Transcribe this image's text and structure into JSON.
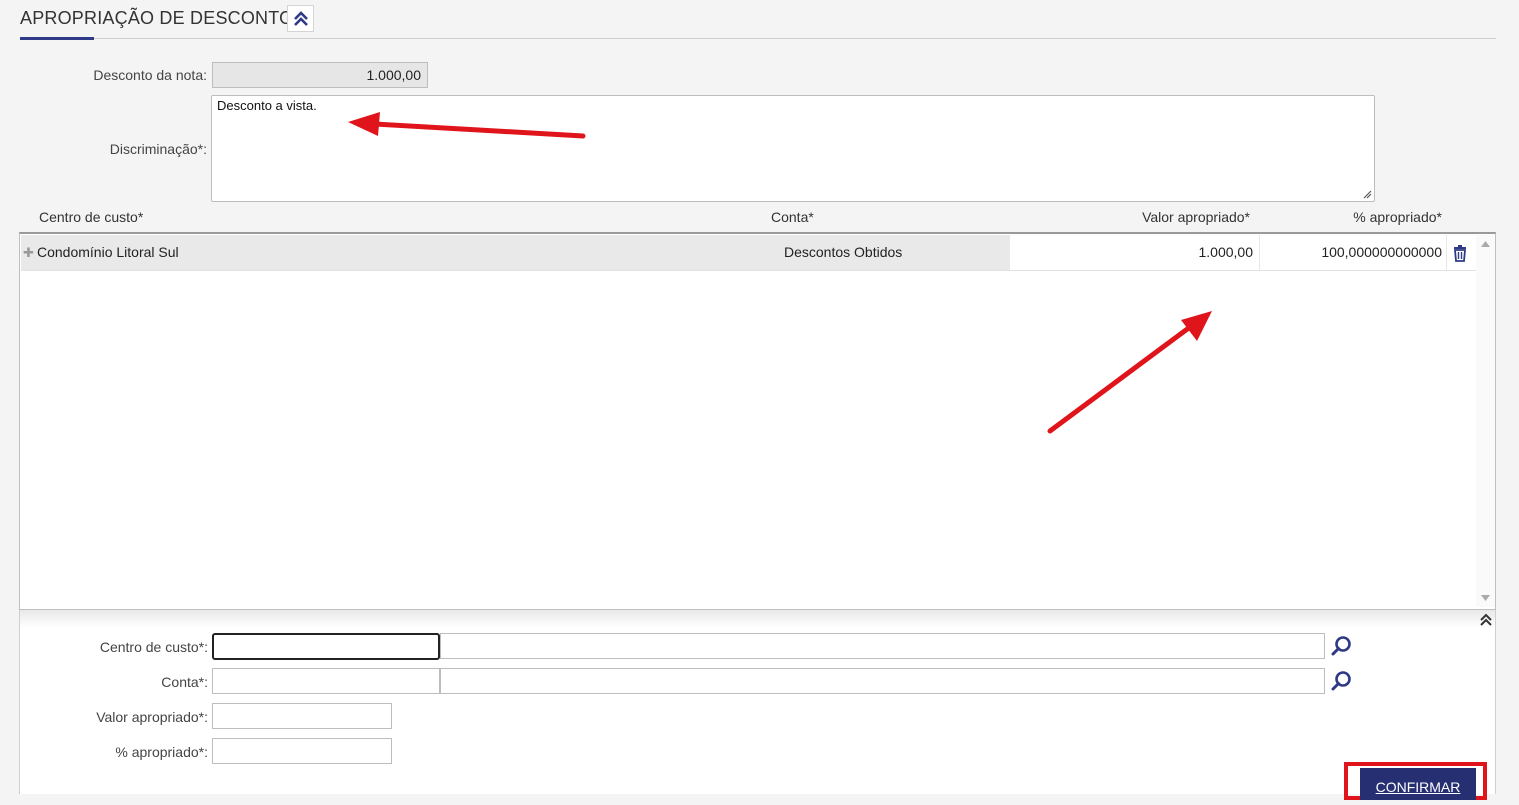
{
  "section": {
    "title": "APROPRIAÇÃO DE DESCONTO",
    "collapse_icon": "double-chevron-up-icon"
  },
  "header_form": {
    "desconto_label": "Desconto da nota:",
    "desconto_value": "1.000,00",
    "discriminacao_label": "Discriminação*:",
    "discriminacao_value": "Desconto a vista."
  },
  "grid": {
    "columns": [
      "Centro de custo*",
      "Conta*",
      "Valor apropriado*",
      "% apropriado*"
    ],
    "rows": [
      {
        "centro_de_custo": "Condomínio Litoral Sul",
        "conta": "Descontos Obtidos",
        "valor_apropriado": "1.000,00",
        "percentual_apropriado": "100,000000000000"
      }
    ],
    "row_expand_icon": "plus-icon",
    "row_delete_icon": "trash-icon"
  },
  "entry_form": {
    "centro_label": "Centro de custo*:",
    "conta_label": "Conta*:",
    "valor_label": "Valor apropriado*:",
    "percent_label": "% apropriado*:",
    "search_icon": "magnifier-icon",
    "collapse_icon": "double-chevron-up-icon"
  },
  "actions": {
    "confirm_label": "CONFIRMAR"
  },
  "colors": {
    "accent": "#2f3a86",
    "button": "#272f73",
    "annotation": "#e0141b"
  }
}
